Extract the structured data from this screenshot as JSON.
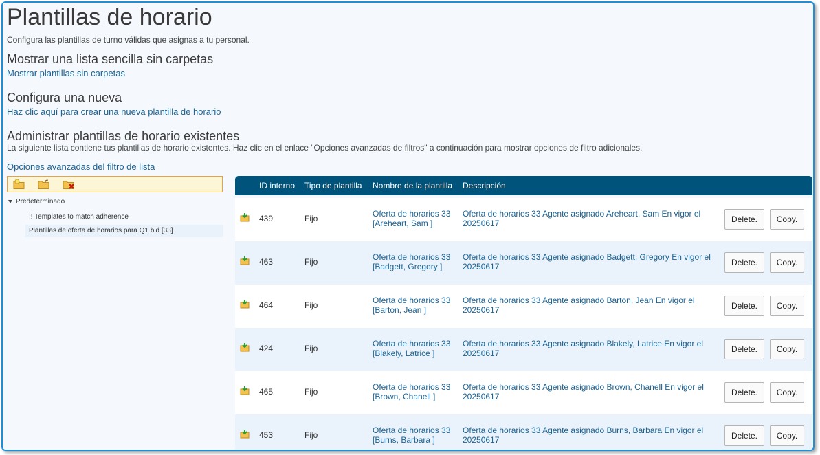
{
  "header": {
    "title": "Plantillas de horario",
    "subtitle": "Configura las plantillas de turno válidas que asignas a tu personal."
  },
  "simple_list": {
    "title": "Mostrar una lista sencilla sin carpetas",
    "link": "Mostrar plantillas sin carpetas"
  },
  "new_template": {
    "title": "Configura una nueva",
    "link": "Haz clic aquí para crear una nueva plantilla de horario"
  },
  "manage": {
    "title": "Administrar plantillas de horario existentes",
    "description": "La siguiente lista contiene tus plantillas de horario existentes. Haz clic en el enlace \"Opciones avanzadas de filtros\" a continuación para mostrar opciones de filtro adicionales.",
    "filter_link": "Opciones avanzadas del filtro de lista"
  },
  "toolbar": {
    "icons": [
      "new-folder-icon",
      "edit-folder-icon",
      "delete-folder-icon"
    ]
  },
  "tree": {
    "root": "Predeterminado",
    "children": [
      "!! Templates to match adherence",
      "Plantillas de oferta de horarios para Q1 bid [33]"
    ]
  },
  "table": {
    "headers": {
      "id": "ID interno",
      "type": "Tipo de plantilla",
      "name": "Nombre de la plantilla",
      "description": "Descripción"
    },
    "delete_label": "Delete.",
    "copy_label": "Copy.",
    "rows": [
      {
        "id": "439",
        "type": "Fijo",
        "name_1": "Oferta de horarios 33",
        "name_2": "[Areheart, Sam ]",
        "desc_1": "Oferta de horarios 33 Agente asignado Areheart, Sam En vigor el",
        "desc_2": "20250617"
      },
      {
        "id": "463",
        "type": "Fijo",
        "name_1": "Oferta de horarios 33",
        "name_2": "[Badgett, Gregory ]",
        "desc_1": "Oferta de horarios 33 Agente asignado Badgett, Gregory En vigor el",
        "desc_2": "20250617"
      },
      {
        "id": "464",
        "type": "Fijo",
        "name_1": "Oferta de horarios 33",
        "name_2": "[Barton, Jean ]",
        "desc_1": "Oferta de horarios 33 Agente asignado Barton, Jean En vigor el",
        "desc_2": "20250617"
      },
      {
        "id": "424",
        "type": "Fijo",
        "name_1": "Oferta de horarios 33",
        "name_2": "[Blakely, Latrice ]",
        "desc_1": "Oferta de horarios 33 Agente asignado Blakely, Latrice En vigor el",
        "desc_2": "20250617"
      },
      {
        "id": "465",
        "type": "Fijo",
        "name_1": "Oferta de horarios 33",
        "name_2": "[Brown, Chanell ]",
        "desc_1": "Oferta de horarios 33 Agente asignado Brown, Chanell En vigor el",
        "desc_2": "20250617"
      },
      {
        "id": "453",
        "type": "Fijo",
        "name_1": "Oferta de horarios 33",
        "name_2": "[Burns, Barbara ]",
        "desc_1": "Oferta de horarios 33 Agente asignado Burns, Barbara En vigor el",
        "desc_2": "20250617"
      }
    ]
  },
  "colors": {
    "header_bg": "#00547c",
    "link": "#1a6496",
    "row_alt": "#eaf3fb",
    "frame_border": "#1e8fd6"
  }
}
